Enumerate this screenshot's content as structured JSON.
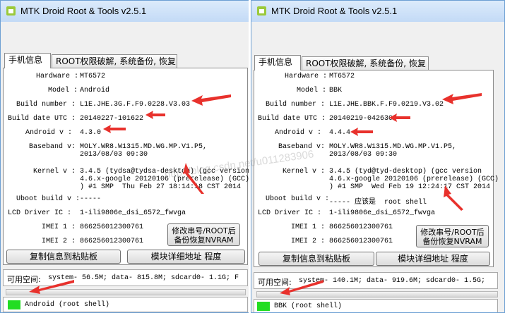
{
  "windows": [
    {
      "title": "MTK Droid Root & Tools v2.5.1",
      "tabs": [
        "手机信息",
        "ROOT权限破解, 系统备份, 恢复"
      ],
      "fields": {
        "hardware": "MT6572",
        "model": "Android",
        "build_number": "L1E.JHE.3G.F.F9.0228.V3.03",
        "build_date": "20140227-101622",
        "android_version": "4.3.0",
        "baseband": "MOLY.WR8.W1315.MD.WG.MP.V1.P5,\n2013/08/03 09:30",
        "kernel": "3.4.5 (tydsa@tydsa-desktop) (gcc version\n4.6.x-google 20120106 (prerelease) (GCC)\n) #1 SMP  Thu Feb 27 18:14:18 CST 2014",
        "uboot": "-----",
        "lcd_driver": "1-ili9806e_dsi_6572_fwvga",
        "imei1": "866256012300761",
        "imei2": "866256012300761"
      },
      "buttons": {
        "copy": "复制信息到粘贴板",
        "block": "模块详细地址 程度",
        "imei_line1": "修改串号/ROOT后",
        "imei_line2": "备份恢复NVRAM"
      },
      "space_label": "可用空间:",
      "space_text": "system- 56.5M; data- 815.8M; sdcard0- 1.1G;  F",
      "status": "Android  (root shell)"
    },
    {
      "title": "MTK Droid Root & Tools v2.5.1",
      "tabs": [
        "手机信息",
        "ROOT权限破解, 系统备份, 恢复"
      ],
      "fields": {
        "hardware": "MT6572",
        "model": "BBK",
        "build_number": "L1E.JHE.BBK.F.F9.0219.V3.02",
        "build_date": "20140219-042630",
        "android_version": "4.4.4",
        "baseband": "MOLY.WR8.W1315.MD.WG.MP.V1.P5,\n2013/08/03 09:30",
        "kernel": "3.4.5 (tyd@tyd-desktop) (gcc version\n4.6.x-google 20120106 (prerelease) (GCC)\n) #1 SMP  Wed Feb 19 12:24:17 CST 2014",
        "uboot": "----- 应该是  root shell",
        "lcd_driver": "1-ili9806e_dsi_6572_fwvga",
        "imei1": "866256012300761",
        "imei2": "866256012300761"
      },
      "buttons": {
        "copy": "复制信息到粘贴板",
        "block": "模块详细地址 程度",
        "imei_line1": "修改串号/ROOT后",
        "imei_line2": "备份恢复NVRAM"
      },
      "space_label": "可用空间:",
      "space_text": "system- 140.1M; data- 919.6M; sdcard0- 1.5G;",
      "status": "BBK  (root shell)"
    }
  ],
  "labels": {
    "hardware": "Hardware  :",
    "model": "Model  :",
    "build_number": "Build number  :",
    "build_date": "Build date UTC  :",
    "android": "Android  v  :",
    "baseband": "Baseband v:",
    "kernel": "Kernel v :",
    "uboot": "Uboot build v :",
    "lcd": "LCD Driver IC  :",
    "imei1": "IMEI 1  :",
    "imei2": "IMEI 2  :"
  },
  "watermark": "http://blog.csdn.net/u011283906",
  "colors": {
    "arrow": "#e8312c",
    "root_ok": "#22dd22",
    "title_bg": "#c9def7"
  }
}
